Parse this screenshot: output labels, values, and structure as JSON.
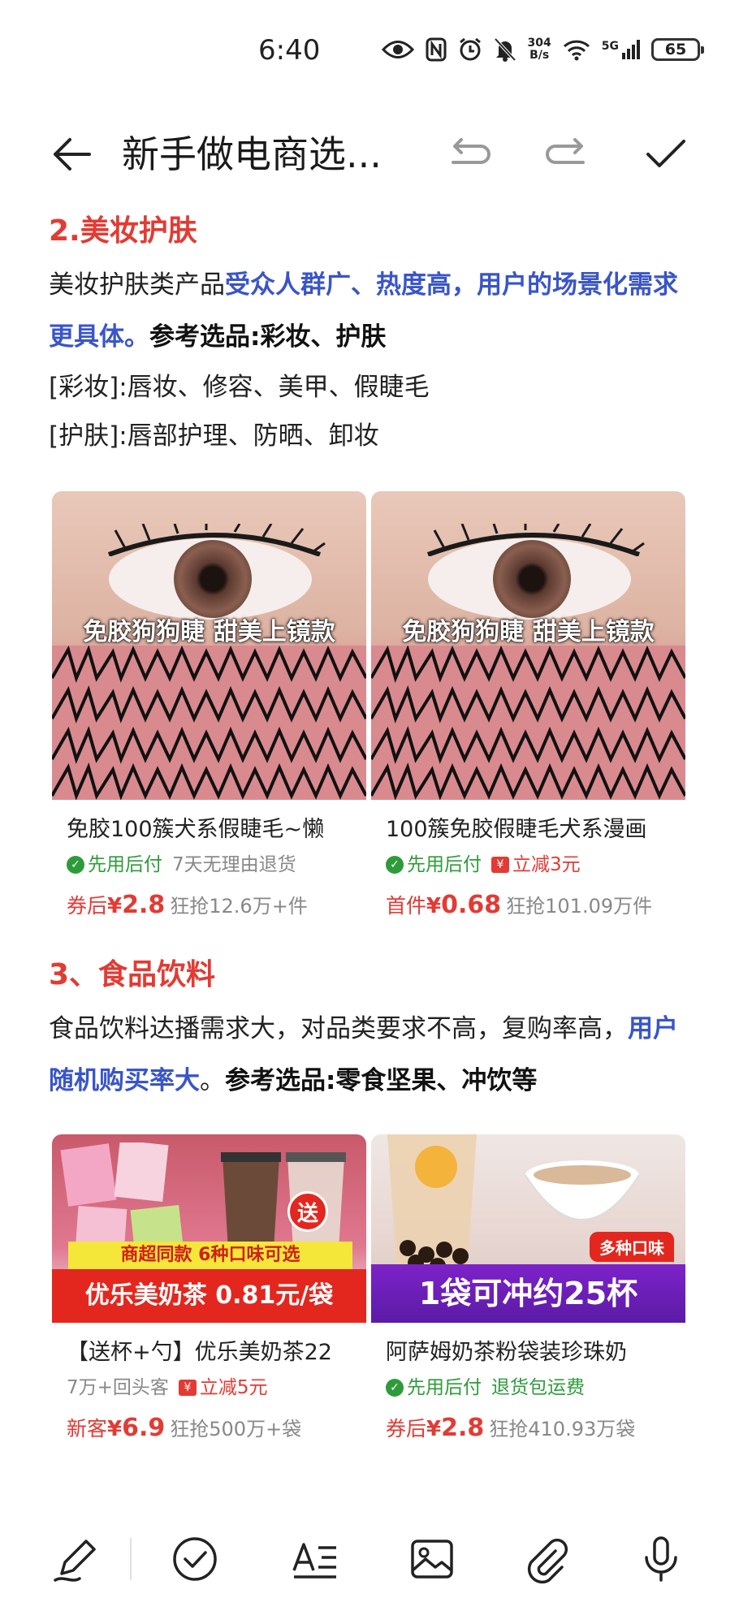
{
  "status_bar": {
    "time": "6:40",
    "net_speed_value": "304",
    "net_speed_unit": "B/s",
    "network_type": "5G",
    "battery": "65"
  },
  "title_bar": {
    "title": "新手做电商选..."
  },
  "section_beauty": {
    "heading": "2.美妆护肤",
    "para_lead": "美妆护肤类产品",
    "para_highlight": "受众人群广、热度高，用户的场景化需求更具体。",
    "para_bold": "参考选品:彩妆、护肤",
    "line_makeup": "[彩妆]:唇妆、修容、美甲、假睫毛",
    "line_skincare": "[护肤]:唇部护理、防晒、卸妆"
  },
  "beauty_products": [
    {
      "image_caption": "免胶狗狗睫 甜美上镜款",
      "title": "免胶100簇犬系假睫毛~懒",
      "tag1": "先用后付",
      "tag2": "7天无理由退货",
      "price_label": "券后",
      "price_symbol": "¥",
      "price": "2.8",
      "sold": "狂抢12.6万+件"
    },
    {
      "image_caption": "免胶狗狗睫 甜美上镜款",
      "title": "100簇免胶假睫毛犬系漫画",
      "tag1": "先用后付",
      "tag2": "立减3元",
      "price_label": "首件",
      "price_symbol": "¥",
      "price": "0.68",
      "sold": "狂抢101.09万件"
    }
  ],
  "section_food": {
    "heading": "3、食品饮料",
    "para_lead": "食品饮料达播需求大，对品类要求不高，复购率高，",
    "para_highlight": "用户随机购买率大",
    "para_period": "。",
    "para_bold": "参考选品:零食坚果、冲饮等"
  },
  "food_products": [
    {
      "image_gift": "送",
      "image_banner_top": "商超同款 6种口味可选",
      "image_banner_main": "优乐美奶茶 0.81元/袋",
      "title": "【送杯+勺】优乐美奶茶22",
      "tag1": "7万+回头客",
      "tag2": "立减5元",
      "price_label": "新客",
      "price_symbol": "¥",
      "price": "6.9",
      "sold": "狂抢500万+袋"
    },
    {
      "image_flavor": "多种口味",
      "image_banner_main": "1袋可冲约25杯",
      "title": "阿萨姆奶茶粉袋装珍珠奶",
      "tag1": "先用后付",
      "tag2": "退货包运费",
      "price_label": "券后",
      "price_symbol": "¥",
      "price": "2.8",
      "sold": "狂抢410.93万袋"
    }
  ],
  "colors": {
    "heading_red": "#e23b34",
    "highlight_blue": "#3a55c8",
    "tag_green": "#2e9b3a"
  },
  "toolbar_icons": [
    "pen-icon",
    "check-circle-icon",
    "text-format-icon",
    "image-icon",
    "attachment-icon",
    "microphone-icon"
  ]
}
